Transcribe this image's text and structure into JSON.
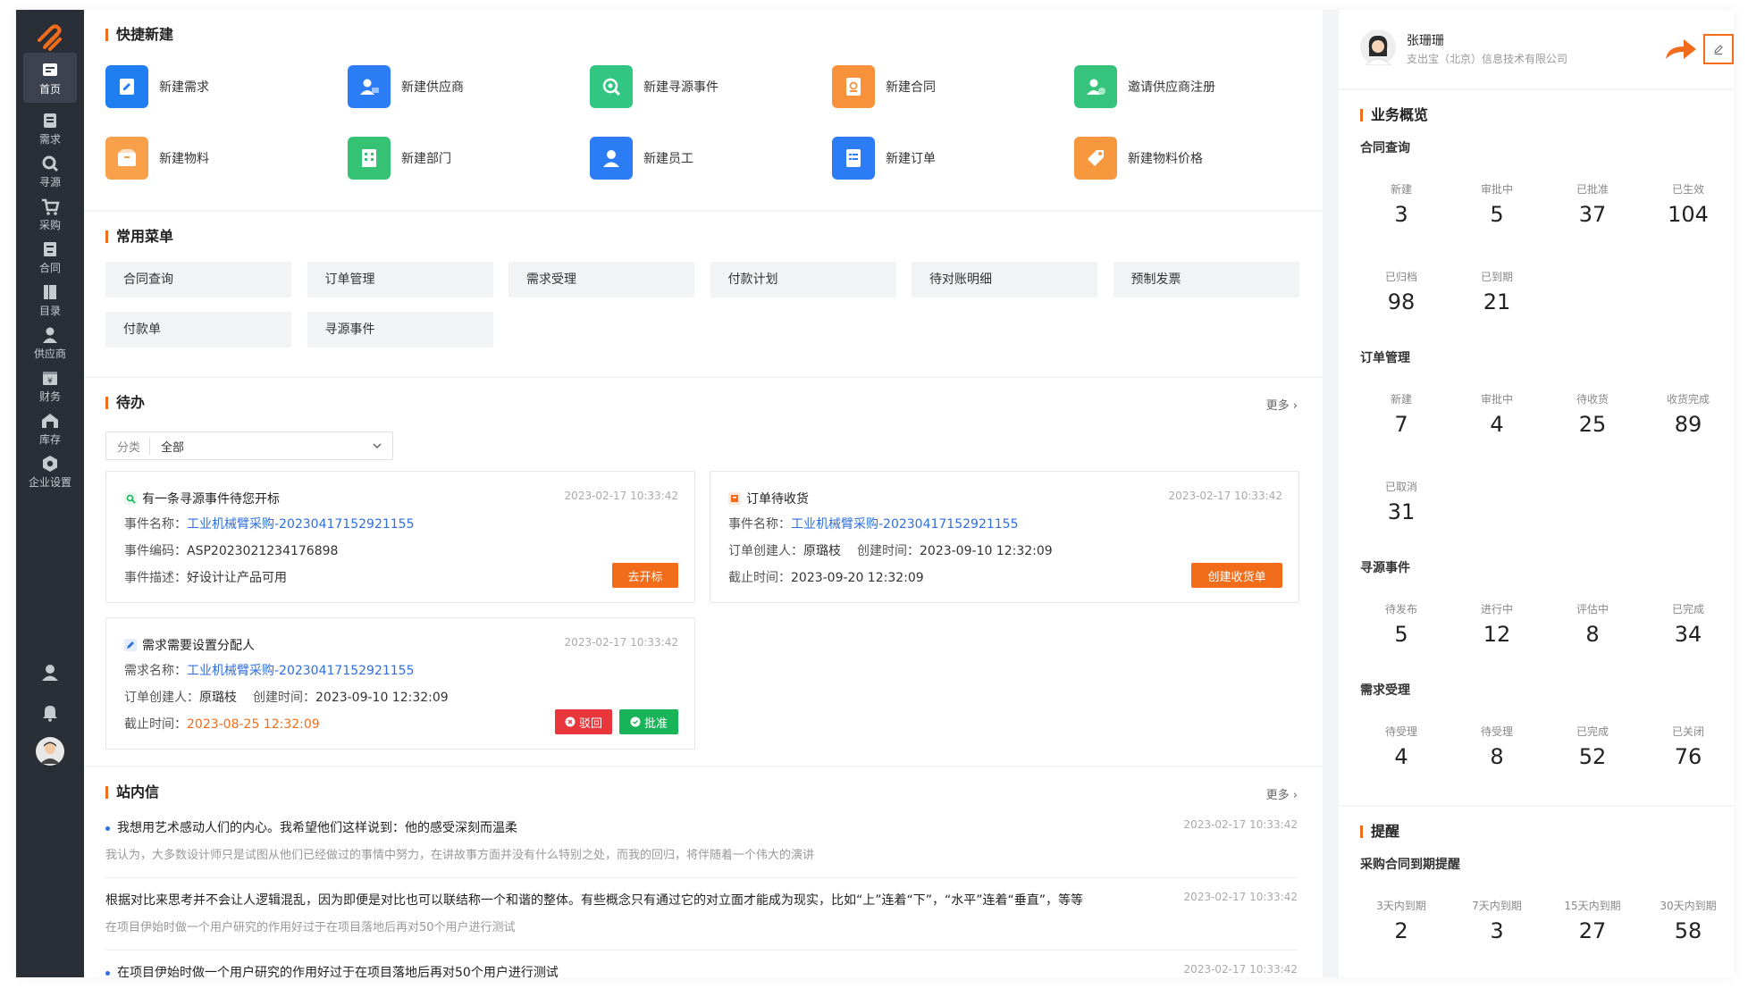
{
  "nav": [
    {
      "label": "首页",
      "icon": "home-icon"
    },
    {
      "label": "需求",
      "icon": "demand-icon"
    },
    {
      "label": "寻源",
      "icon": "sourcing-icon"
    },
    {
      "label": "采购",
      "icon": "cart-icon"
    },
    {
      "label": "合同",
      "icon": "contract-icon"
    },
    {
      "label": "目录",
      "icon": "catalog-icon"
    },
    {
      "label": "供应商",
      "icon": "supplier-icon"
    },
    {
      "label": "财务",
      "icon": "finance-icon"
    },
    {
      "label": "库存",
      "icon": "warehouse-icon"
    },
    {
      "label": "企业设置",
      "icon": "settings-icon"
    }
  ],
  "quick_create": {
    "title": "快捷新建",
    "items": [
      {
        "label": "新建需求",
        "color": "#1f7ef0"
      },
      {
        "label": "新建供应商",
        "color": "#2c7cf6"
      },
      {
        "label": "新建寻源事件",
        "color": "#31c783"
      },
      {
        "label": "新建合同",
        "color": "#f7923b"
      },
      {
        "label": "邀请供应商注册",
        "color": "#36c47c"
      },
      {
        "label": "新建物料",
        "color": "#f8a04a"
      },
      {
        "label": "新建部门",
        "color": "#35c274"
      },
      {
        "label": "新建员工",
        "color": "#2c7cf6"
      },
      {
        "label": "新建订单",
        "color": "#2c7cf6"
      },
      {
        "label": "新建物料价格",
        "color": "#f7973e"
      }
    ]
  },
  "common_menu": {
    "title": "常用菜单",
    "items": [
      "合同查询",
      "订单管理",
      "需求受理",
      "付款计划",
      "待对账明细",
      "预制发票",
      "付款单",
      "寻源事件"
    ]
  },
  "todo": {
    "title": "待办",
    "more": "更多",
    "filter_label": "分类",
    "filter_value": "全部",
    "cards": [
      {
        "title": "有一条寻源事件待您开标",
        "time": "2023-02-17 10:33:42",
        "l1k": "事件名称：",
        "l1v": "工业机械臂采购-20230417152921155",
        "l2k": "事件编码：",
        "l2v": "ASP2023021234176898",
        "l3k": "事件描述：",
        "l3v": "好设计让产品可用",
        "button": "去开标"
      },
      {
        "title": "订单待收货",
        "time": "2023-02-17 10:33:42",
        "l1k": "事件名称：",
        "l1v": "工业机械臂采购-20230417152921155",
        "l2k": "订单创建人：",
        "l2v": "原璐枝",
        "l2bk": "创建时间：",
        "l2bv": "2023-09-10 12:32:09",
        "l3k": "截止时间：",
        "l3v": "2023-09-20 12:32:09",
        "button": "创建收货单"
      },
      {
        "title": "需求需要设置分配人",
        "time": "2023-02-17 10:33:42",
        "l1k": "需求名称：",
        "l1v": "工业机械臂采购-20230417152921155",
        "l2k": "订单创建人：",
        "l2v": "原璐枝",
        "l2bk": "创建时间：",
        "l2bv": "2023-09-10 12:32:09",
        "l3k": "截止时间：",
        "l3v": "2023-08-25 12:32:09",
        "reject": "驳回",
        "approve": "批准"
      }
    ]
  },
  "messages": {
    "title": "站内信",
    "more": "更多",
    "items": [
      {
        "title": "我想用艺术感动人们的内心。我希望他们这样说到：他的感受深刻而温柔",
        "sub": "我认为，大多数设计师只是试图从他们已经做过的事情中努力，在讲故事方面并没有什么特别之处，而我的回归，将伴随着一个伟大的演讲",
        "time": "2023-02-17 10:33:42"
      },
      {
        "title": "根据对比来思考并不会让人逻辑混乱，因为即便是对比也可以联结称一个和谐的整体。有些概念只有通过它的对立面才能成为现实，比如“上”连着“下”，“水平”连着“垂直”，等等",
        "sub": "在项目伊始时做一个用户研究的作用好过于在项目落地后再对50个用户进行测试",
        "time": "2023-02-17 10:33:42"
      },
      {
        "title": "在项目伊始时做一个用户研究的作用好过于在项目落地后再对50个用户进行测试",
        "sub": "",
        "time": "2023-02-17 10:33:42"
      }
    ]
  },
  "profile": {
    "name": "张珊珊",
    "company": "支出宝（北京）信息技术有限公司"
  },
  "overview": {
    "title": "业务概览",
    "groups": [
      {
        "title": "合同查询",
        "stats": [
          {
            "label": "新建",
            "value": "3"
          },
          {
            "label": "审批中",
            "value": "5"
          },
          {
            "label": "已批准",
            "value": "37"
          },
          {
            "label": "已生效",
            "value": "104"
          },
          {
            "label": "已归档",
            "value": "98"
          },
          {
            "label": "已到期",
            "value": "21"
          }
        ]
      },
      {
        "title": "订单管理",
        "stats": [
          {
            "label": "新建",
            "value": "7"
          },
          {
            "label": "审批中",
            "value": "4"
          },
          {
            "label": "待收货",
            "value": "25"
          },
          {
            "label": "收货完成",
            "value": "89"
          },
          {
            "label": "已取消",
            "value": "31"
          }
        ]
      },
      {
        "title": "寻源事件",
        "stats": [
          {
            "label": "待发布",
            "value": "5"
          },
          {
            "label": "进行中",
            "value": "12"
          },
          {
            "label": "评估中",
            "value": "8"
          },
          {
            "label": "已完成",
            "value": "34"
          }
        ]
      },
      {
        "title": "需求受理",
        "stats": [
          {
            "label": "待受理",
            "value": "4"
          },
          {
            "label": "待受理",
            "value": "8"
          },
          {
            "label": "已完成",
            "value": "52"
          },
          {
            "label": "已关闭",
            "value": "76"
          }
        ]
      }
    ]
  },
  "reminder": {
    "title": "提醒",
    "subtitle": "采购合同到期提醒",
    "stats": [
      {
        "label": "3天内到期",
        "value": "2"
      },
      {
        "label": "7天内到期",
        "value": "3"
      },
      {
        "label": "15天内到期",
        "value": "27"
      },
      {
        "label": "30天内到期",
        "value": "58"
      }
    ]
  },
  "colors": {
    "accent": "#f26d1b",
    "link": "#2f6fde",
    "sidebar": "#2a2e37",
    "danger": "#e8363c",
    "success": "#18b558"
  }
}
